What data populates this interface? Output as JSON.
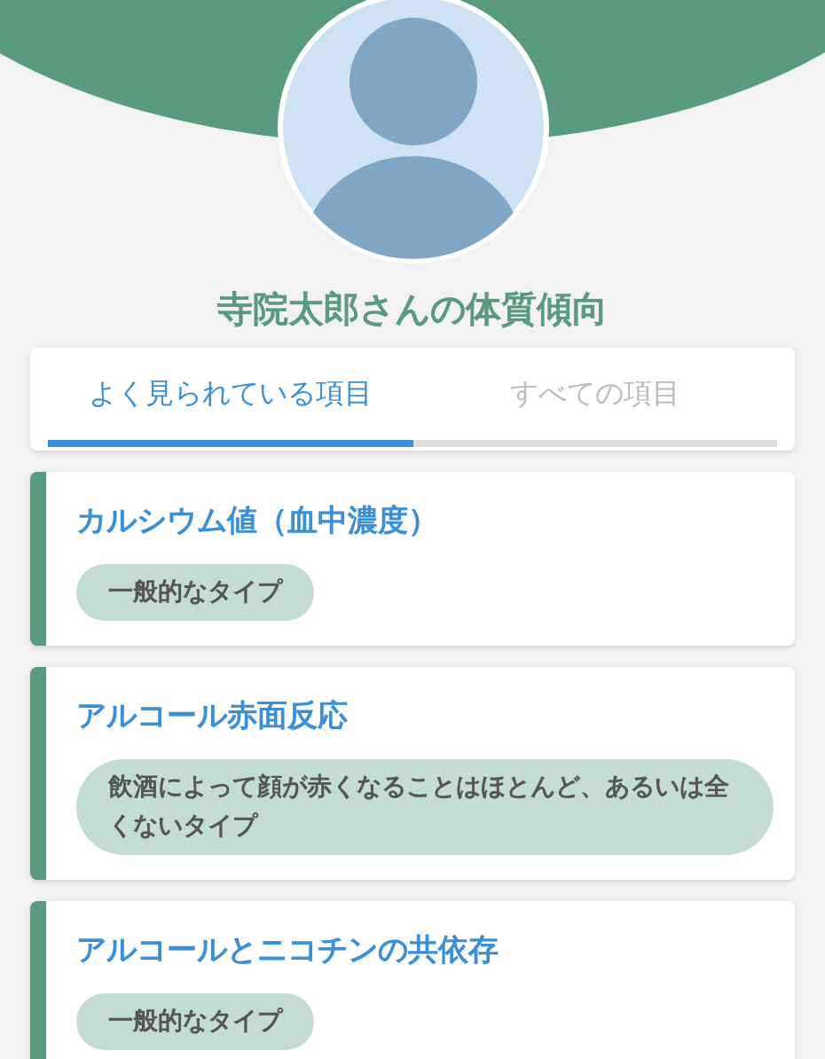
{
  "title": "寺院太郎さんの体質傾向",
  "tabs": [
    {
      "label": "よく見られている項目",
      "selected": true
    },
    {
      "label": "すべての項目",
      "selected": false
    }
  ],
  "items": [
    {
      "name": "カルシウム値（血中濃度）",
      "result": "一般的なタイプ"
    },
    {
      "name": "アルコール赤面反応",
      "result": "飲酒によって顔が赤くなることはほとんど、あるいは全くないタイプ"
    },
    {
      "name": "アルコールとニコチンの共依存",
      "result": "一般的なタイプ"
    }
  ]
}
